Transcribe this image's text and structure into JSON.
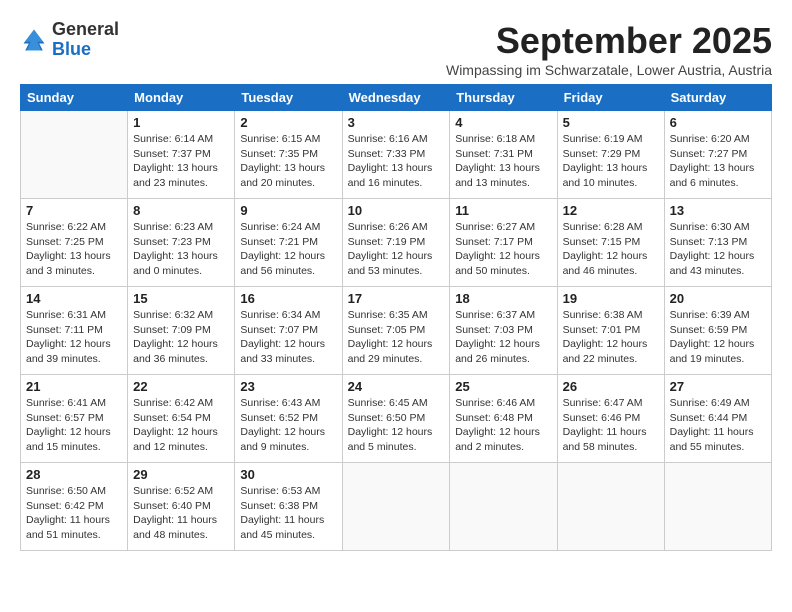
{
  "logo": {
    "general": "General",
    "blue": "Blue"
  },
  "header": {
    "month": "September 2025",
    "subtitle": "Wimpassing im Schwarzatale, Lower Austria, Austria"
  },
  "weekdays": [
    "Sunday",
    "Monday",
    "Tuesday",
    "Wednesday",
    "Thursday",
    "Friday",
    "Saturday"
  ],
  "weeks": [
    [
      {
        "day": "",
        "info": ""
      },
      {
        "day": "1",
        "info": "Sunrise: 6:14 AM\nSunset: 7:37 PM\nDaylight: 13 hours\nand 23 minutes."
      },
      {
        "day": "2",
        "info": "Sunrise: 6:15 AM\nSunset: 7:35 PM\nDaylight: 13 hours\nand 20 minutes."
      },
      {
        "day": "3",
        "info": "Sunrise: 6:16 AM\nSunset: 7:33 PM\nDaylight: 13 hours\nand 16 minutes."
      },
      {
        "day": "4",
        "info": "Sunrise: 6:18 AM\nSunset: 7:31 PM\nDaylight: 13 hours\nand 13 minutes."
      },
      {
        "day": "5",
        "info": "Sunrise: 6:19 AM\nSunset: 7:29 PM\nDaylight: 13 hours\nand 10 minutes."
      },
      {
        "day": "6",
        "info": "Sunrise: 6:20 AM\nSunset: 7:27 PM\nDaylight: 13 hours\nand 6 minutes."
      }
    ],
    [
      {
        "day": "7",
        "info": "Sunrise: 6:22 AM\nSunset: 7:25 PM\nDaylight: 13 hours\nand 3 minutes."
      },
      {
        "day": "8",
        "info": "Sunrise: 6:23 AM\nSunset: 7:23 PM\nDaylight: 13 hours\nand 0 minutes."
      },
      {
        "day": "9",
        "info": "Sunrise: 6:24 AM\nSunset: 7:21 PM\nDaylight: 12 hours\nand 56 minutes."
      },
      {
        "day": "10",
        "info": "Sunrise: 6:26 AM\nSunset: 7:19 PM\nDaylight: 12 hours\nand 53 minutes."
      },
      {
        "day": "11",
        "info": "Sunrise: 6:27 AM\nSunset: 7:17 PM\nDaylight: 12 hours\nand 50 minutes."
      },
      {
        "day": "12",
        "info": "Sunrise: 6:28 AM\nSunset: 7:15 PM\nDaylight: 12 hours\nand 46 minutes."
      },
      {
        "day": "13",
        "info": "Sunrise: 6:30 AM\nSunset: 7:13 PM\nDaylight: 12 hours\nand 43 minutes."
      }
    ],
    [
      {
        "day": "14",
        "info": "Sunrise: 6:31 AM\nSunset: 7:11 PM\nDaylight: 12 hours\nand 39 minutes."
      },
      {
        "day": "15",
        "info": "Sunrise: 6:32 AM\nSunset: 7:09 PM\nDaylight: 12 hours\nand 36 minutes."
      },
      {
        "day": "16",
        "info": "Sunrise: 6:34 AM\nSunset: 7:07 PM\nDaylight: 12 hours\nand 33 minutes."
      },
      {
        "day": "17",
        "info": "Sunrise: 6:35 AM\nSunset: 7:05 PM\nDaylight: 12 hours\nand 29 minutes."
      },
      {
        "day": "18",
        "info": "Sunrise: 6:37 AM\nSunset: 7:03 PM\nDaylight: 12 hours\nand 26 minutes."
      },
      {
        "day": "19",
        "info": "Sunrise: 6:38 AM\nSunset: 7:01 PM\nDaylight: 12 hours\nand 22 minutes."
      },
      {
        "day": "20",
        "info": "Sunrise: 6:39 AM\nSunset: 6:59 PM\nDaylight: 12 hours\nand 19 minutes."
      }
    ],
    [
      {
        "day": "21",
        "info": "Sunrise: 6:41 AM\nSunset: 6:57 PM\nDaylight: 12 hours\nand 15 minutes."
      },
      {
        "day": "22",
        "info": "Sunrise: 6:42 AM\nSunset: 6:54 PM\nDaylight: 12 hours\nand 12 minutes."
      },
      {
        "day": "23",
        "info": "Sunrise: 6:43 AM\nSunset: 6:52 PM\nDaylight: 12 hours\nand 9 minutes."
      },
      {
        "day": "24",
        "info": "Sunrise: 6:45 AM\nSunset: 6:50 PM\nDaylight: 12 hours\nand 5 minutes."
      },
      {
        "day": "25",
        "info": "Sunrise: 6:46 AM\nSunset: 6:48 PM\nDaylight: 12 hours\nand 2 minutes."
      },
      {
        "day": "26",
        "info": "Sunrise: 6:47 AM\nSunset: 6:46 PM\nDaylight: 11 hours\nand 58 minutes."
      },
      {
        "day": "27",
        "info": "Sunrise: 6:49 AM\nSunset: 6:44 PM\nDaylight: 11 hours\nand 55 minutes."
      }
    ],
    [
      {
        "day": "28",
        "info": "Sunrise: 6:50 AM\nSunset: 6:42 PM\nDaylight: 11 hours\nand 51 minutes."
      },
      {
        "day": "29",
        "info": "Sunrise: 6:52 AM\nSunset: 6:40 PM\nDaylight: 11 hours\nand 48 minutes."
      },
      {
        "day": "30",
        "info": "Sunrise: 6:53 AM\nSunset: 6:38 PM\nDaylight: 11 hours\nand 45 minutes."
      },
      {
        "day": "",
        "info": ""
      },
      {
        "day": "",
        "info": ""
      },
      {
        "day": "",
        "info": ""
      },
      {
        "day": "",
        "info": ""
      }
    ]
  ]
}
